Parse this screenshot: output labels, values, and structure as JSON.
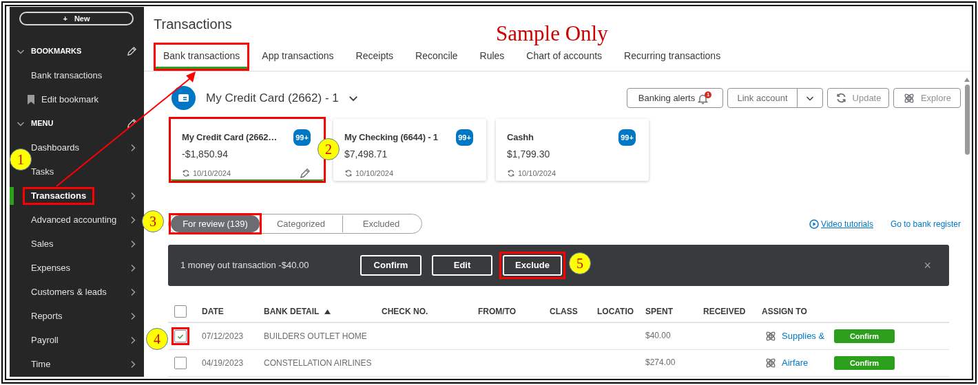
{
  "annotations": {
    "caption": "Sample Only",
    "callouts": [
      {
        "number": "1"
      },
      {
        "number": "2"
      },
      {
        "number": "3"
      },
      {
        "number": "4"
      },
      {
        "number": "5"
      }
    ]
  },
  "sidebar": {
    "new_button": {
      "icon": "+",
      "label": "New"
    },
    "bookmarks": {
      "title": "BOOKMARKS",
      "expanded": true,
      "editable": true,
      "items": [
        {
          "label": "Bank transactions",
          "kind": "link"
        },
        {
          "label": "Edit bookmark",
          "kind": "edit"
        }
      ]
    },
    "menu": {
      "title": "MENU",
      "expanded": true,
      "editable": true,
      "items": [
        {
          "label": "Dashboards",
          "selected": false,
          "highlighted": false,
          "submenu": true
        },
        {
          "label": "Tasks",
          "selected": false,
          "highlighted": false,
          "submenu": false
        },
        {
          "label": "Transactions",
          "selected": true,
          "highlighted": true,
          "submenu": true
        },
        {
          "label": "Advanced accounting",
          "selected": false,
          "highlighted": false,
          "submenu": true
        },
        {
          "label": "Sales",
          "selected": false,
          "highlighted": false,
          "submenu": true
        },
        {
          "label": "Expenses",
          "selected": false,
          "highlighted": false,
          "submenu": true
        },
        {
          "label": "Customers & leads",
          "selected": false,
          "highlighted": false,
          "submenu": true
        },
        {
          "label": "Reports",
          "selected": false,
          "highlighted": false,
          "submenu": true
        },
        {
          "label": "Payroll",
          "selected": false,
          "highlighted": false,
          "submenu": true
        },
        {
          "label": "Time",
          "selected": false,
          "highlighted": false,
          "submenu": true
        }
      ]
    }
  },
  "page": {
    "title": "Transactions",
    "tabs": [
      {
        "label": "Bank transactions",
        "selected": true,
        "highlighted": true
      },
      {
        "label": "App transactions",
        "selected": false,
        "highlighted": false
      },
      {
        "label": "Receipts",
        "selected": false,
        "highlighted": false
      },
      {
        "label": "Reconcile",
        "selected": false,
        "highlighted": false
      },
      {
        "label": "Rules",
        "selected": false,
        "highlighted": false
      },
      {
        "label": "Chart of accounts",
        "selected": false,
        "highlighted": false
      },
      {
        "label": "Recurring transactions",
        "selected": false,
        "highlighted": false
      }
    ],
    "account_selector": {
      "name": "My Credit Card (2662) - 1"
    },
    "actions": {
      "banking_alerts": {
        "label": "Banking alerts",
        "badge": "1"
      },
      "link_account": {
        "label": "Link account"
      },
      "update": {
        "label": "Update"
      },
      "explore": {
        "label": "Explore"
      }
    },
    "accounts": [
      {
        "name": "My Credit Card (2662…",
        "badge": "99+",
        "balance": "-$1,850.94",
        "date": "10/10/2024",
        "selected": true,
        "highlighted": true,
        "editable": true
      },
      {
        "name": "My Checking (6644) - 1",
        "badge": "99+",
        "balance": "$7,498.71",
        "date": "10/10/2024",
        "selected": false,
        "highlighted": false,
        "editable": false
      },
      {
        "name": "Cashh",
        "badge": "99+",
        "balance": "$1,799.30",
        "date": "10/10/2024",
        "selected": false,
        "highlighted": false,
        "editable": false
      }
    ],
    "review_tabs": [
      {
        "label": "For review (139)",
        "selected": true,
        "highlighted": true
      },
      {
        "label": "Categorized",
        "selected": false,
        "highlighted": false
      },
      {
        "label": "Excluded",
        "selected": false,
        "highlighted": false
      }
    ],
    "links": [
      {
        "label": "Video tutorials",
        "kind": "video"
      },
      {
        "label": "Go to bank register",
        "kind": "plain"
      }
    ],
    "batch_bar": {
      "message": "1 money out transaction -$40.00",
      "close": "×",
      "buttons": [
        {
          "label": "Confirm",
          "highlighted": false
        },
        {
          "label": "Edit",
          "highlighted": false
        },
        {
          "label": "Exclude",
          "highlighted": true
        }
      ]
    },
    "table": {
      "select_all_checked": false,
      "columns": [
        {
          "label": "DATE",
          "sorted": false
        },
        {
          "label": "BANK DETAIL",
          "sorted": true
        },
        {
          "label": "CHECK NO.",
          "sorted": false
        },
        {
          "label": "FROM/TO",
          "sorted": false
        },
        {
          "label": "CLASS",
          "sorted": false
        },
        {
          "label": "LOCATIO",
          "sorted": false
        },
        {
          "label": "SPENT",
          "sorted": false
        },
        {
          "label": "RECEIVED",
          "sorted": false
        },
        {
          "label": "ASSIGN TO",
          "sorted": false
        }
      ],
      "rows": [
        {
          "checked": true,
          "highlighted": true,
          "date": "07/12/2023",
          "bank_detail": "BUILDERS OUTLET HOME",
          "spent": "$40.00",
          "assign_to": "Supplies &",
          "action": "Confirm"
        },
        {
          "checked": false,
          "highlighted": false,
          "date": "04/19/2023",
          "bank_detail": "CONSTELLATION AIRLINES",
          "spent": "$274.00",
          "assign_to": "Airfare",
          "action": "Confirm"
        }
      ]
    }
  }
}
